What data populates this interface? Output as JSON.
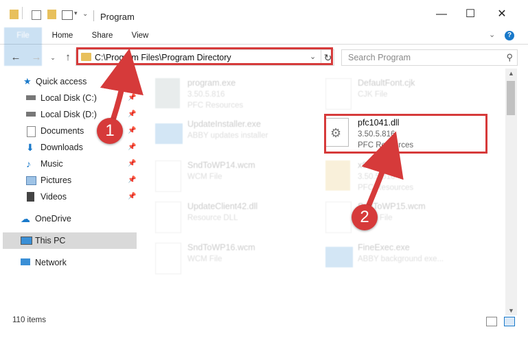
{
  "window": {
    "title": "Program"
  },
  "ribbon": {
    "tabs": [
      "File",
      "Home",
      "Share",
      "View"
    ]
  },
  "address": {
    "path": "C:\\Program Files\\Program Directory"
  },
  "search": {
    "placeholder": "Search Program"
  },
  "sidebar": {
    "quick_access": "Quick access",
    "items": [
      "Local Disk (C:)",
      "Local Disk (D:)",
      "Documents",
      "Downloads",
      "Music",
      "Pictures",
      "Videos"
    ],
    "onedrive": "OneDrive",
    "thispc": "This PC",
    "network": "Network"
  },
  "files": [
    {
      "name": "program.exe",
      "line1": "3.50.5.816",
      "line2": "PFC Resources"
    },
    {
      "name": "DefaultFont.cjk",
      "line1": "CJK File",
      "line2": ""
    },
    {
      "name": "UpdateInstaller.exe",
      "line1": "ABBY updates installer",
      "line2": ""
    },
    {
      "name": "pfc1041.dll",
      "line1": "3.50.5.816",
      "line2": "PFC Resources"
    },
    {
      "name": "SndToWP14.wcm",
      "line1": "WCM File",
      "line2": ""
    },
    {
      "name": "x64",
      "line1": "3.50.5.816",
      "line2": "PFC Resources"
    },
    {
      "name": "UpdateClient42.dll",
      "line1": "Resource DLL",
      "line2": ""
    },
    {
      "name": "SndToWP15.wcm",
      "line1": "WCM File",
      "line2": ""
    },
    {
      "name": "SndToWP16.wcm",
      "line1": "WCM File",
      "line2": ""
    },
    {
      "name": "FineExec.exe",
      "line1": "ABBY background exe...",
      "line2": ""
    }
  ],
  "status": {
    "items": "110 items"
  },
  "badges": {
    "one": "1",
    "two": "2"
  },
  "colors": {
    "accent": "#1979ca",
    "highlight": "#d63a3a"
  }
}
